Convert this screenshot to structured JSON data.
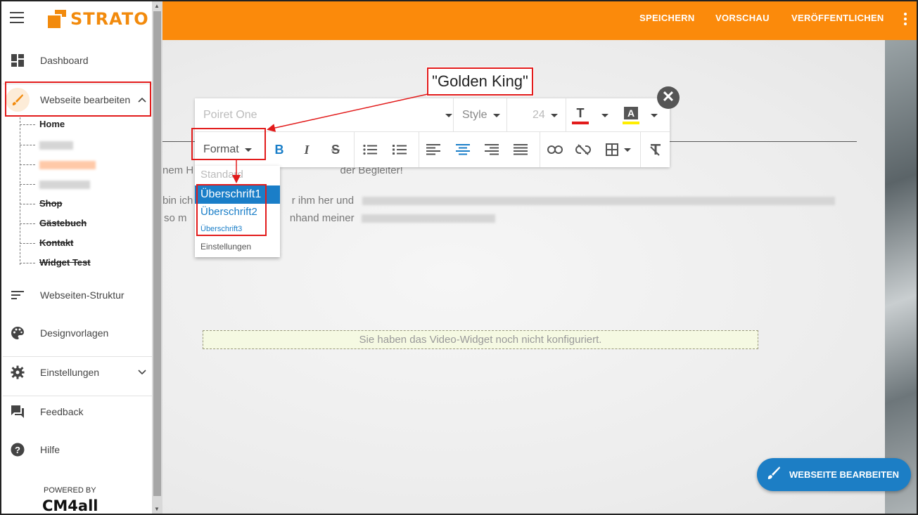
{
  "brand": {
    "name": "STRATO",
    "powered_by": "POWERED BY",
    "cm4all": "CM4all"
  },
  "sidebar": {
    "items": [
      {
        "label": "Dashboard",
        "icon": "dashboard-icon"
      },
      {
        "label": "Webseite bearbeiten",
        "icon": "brush-icon"
      },
      {
        "label": "Webseiten-Struktur",
        "icon": "structure-icon"
      },
      {
        "label": "Designvorlagen",
        "icon": "palette-icon"
      },
      {
        "label": "Einstellungen",
        "icon": "gear-icon"
      },
      {
        "label": "Feedback",
        "icon": "feedback-icon"
      },
      {
        "label": "Hilfe",
        "icon": "help-icon"
      }
    ],
    "subpages": [
      {
        "label": "Home"
      },
      {
        "label": "Shop"
      },
      {
        "label": "Gästebuch"
      },
      {
        "label": "Kontakt"
      },
      {
        "label": "Widget Test"
      }
    ]
  },
  "topbar": {
    "save": "SPEICHERN",
    "preview": "VORSCHAU",
    "publish": "VERÖFFENTLICHEN"
  },
  "toolbar": {
    "font": "Poiret One",
    "style": "Style",
    "size": "24",
    "format": "Format",
    "text_color": "#e21b1b",
    "bg_color": "#ffee00"
  },
  "format_menu": {
    "standard": "Standard",
    "h1": "Überschrift1",
    "h2": "Überschrift2",
    "h3": "Überschrift3",
    "settings": "Einstellungen"
  },
  "callout": {
    "text": "\"Golden King\""
  },
  "content": {
    "line1a": "nem H",
    "line1b": "der Begleiter!",
    "line2a": "bin ich",
    "line2b": "r ihm her und",
    "line3a": "so m",
    "line3b": "nhand meiner",
    "video": "Sie haben das Video-Widget noch nicht konfiguriert."
  },
  "fab": {
    "label": "WEBSEITE BEARBEITEN"
  }
}
